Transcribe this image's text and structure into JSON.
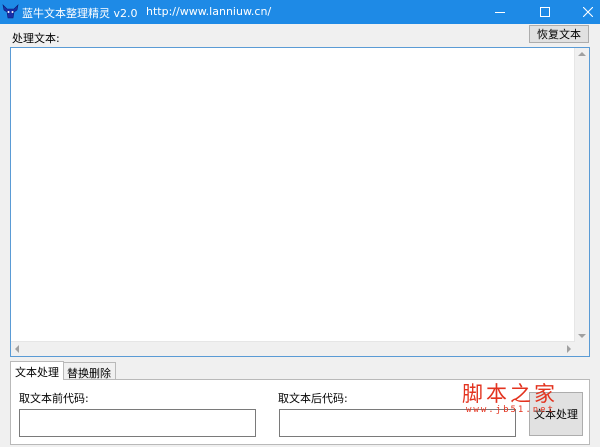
{
  "window": {
    "title": "蓝牛文本整理精灵 v2.0",
    "url": "http://www.lanniuw.cn/",
    "accent_color": "#1e8ae6"
  },
  "main": {
    "process_label": "处理文本:",
    "restore_button": "恢复文本",
    "text_content": ""
  },
  "tabs": [
    {
      "label": "文本处理",
      "active": true
    },
    {
      "label": "替换删除",
      "active": false
    }
  ],
  "panel": {
    "before_label": "取文本前代码:",
    "before_value": "",
    "after_label": "取文本后代码:",
    "after_value": "",
    "process_button": "文本处理"
  },
  "watermark": {
    "text": "脚本之家",
    "sub": "www.jb51.net",
    "color": "#e3331f"
  }
}
